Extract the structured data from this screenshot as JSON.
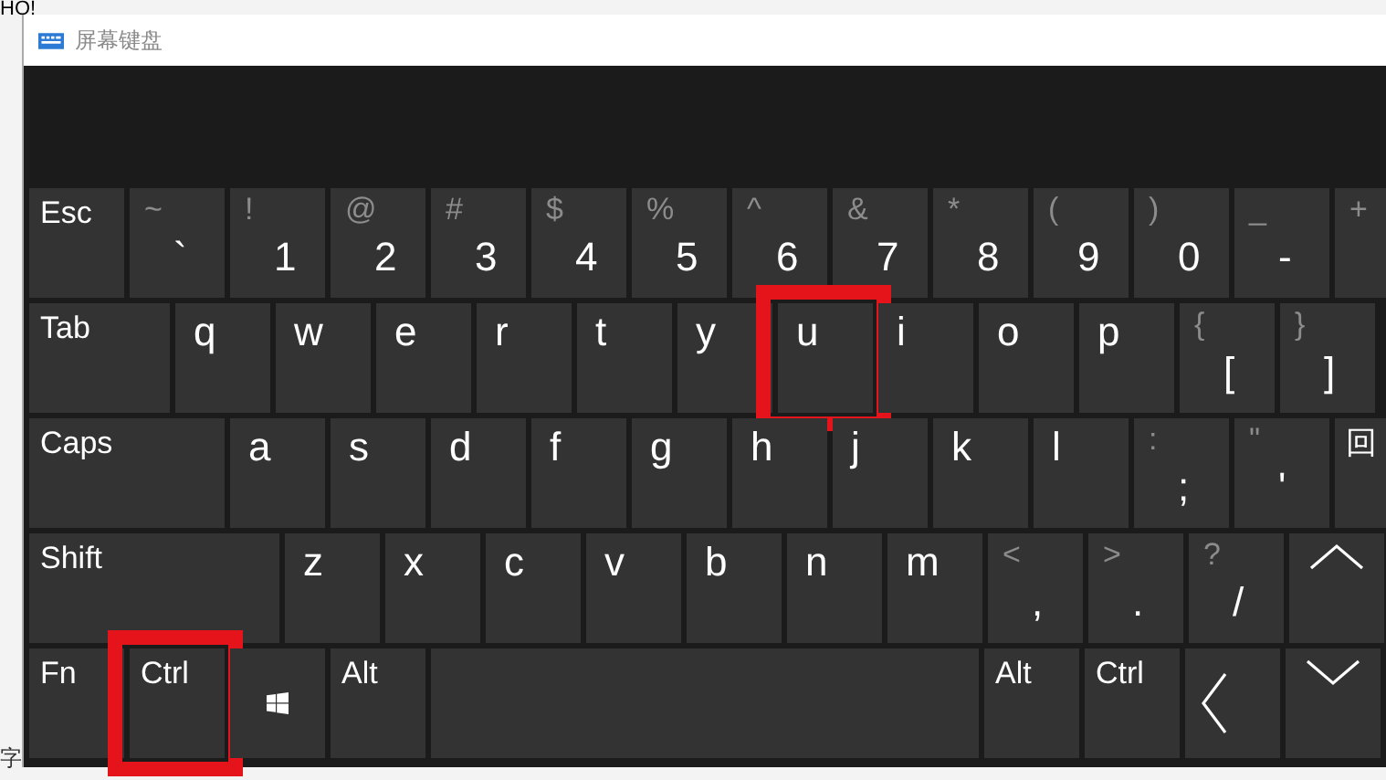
{
  "background_texts": [
    "HO!",
    "字"
  ],
  "window": {
    "title": "屏幕键盘"
  },
  "rows": [
    {
      "keys": [
        {
          "kind": "label",
          "label": "Esc"
        },
        {
          "kind": "symbol",
          "shift": "~",
          "main": "`"
        },
        {
          "kind": "symbol",
          "shift": "!",
          "main": "1"
        },
        {
          "kind": "symbol",
          "shift": "@",
          "main": "2"
        },
        {
          "kind": "symbol",
          "shift": "#",
          "main": "3"
        },
        {
          "kind": "symbol",
          "shift": "$",
          "main": "4"
        },
        {
          "kind": "symbol",
          "shift": "%",
          "main": "5"
        },
        {
          "kind": "symbol",
          "shift": "^",
          "main": "6"
        },
        {
          "kind": "symbol",
          "shift": "&",
          "main": "7"
        },
        {
          "kind": "symbol",
          "shift": "*",
          "main": "8"
        },
        {
          "kind": "symbol",
          "shift": "(",
          "main": "9"
        },
        {
          "kind": "symbol",
          "shift": ")",
          "main": "0"
        },
        {
          "kind": "symbol",
          "shift": "_",
          "main": "-"
        },
        {
          "kind": "symbol",
          "shift": "+"
        }
      ]
    },
    {
      "keys": [
        {
          "kind": "label",
          "label": "Tab"
        },
        {
          "kind": "letter",
          "label": "q"
        },
        {
          "kind": "letter",
          "label": "w"
        },
        {
          "kind": "letter",
          "label": "e"
        },
        {
          "kind": "letter",
          "label": "r"
        },
        {
          "kind": "letter",
          "label": "t"
        },
        {
          "kind": "letter",
          "label": "y"
        },
        {
          "kind": "letter",
          "label": "u",
          "highlighted": true
        },
        {
          "kind": "letter",
          "label": "i"
        },
        {
          "kind": "letter",
          "label": "o"
        },
        {
          "kind": "letter",
          "label": "p"
        },
        {
          "kind": "symbol",
          "shift": "{",
          "main": "["
        },
        {
          "kind": "symbol",
          "shift": "}",
          "main": "]"
        }
      ]
    },
    {
      "keys": [
        {
          "kind": "label",
          "label": "Caps"
        },
        {
          "kind": "letter",
          "label": "a"
        },
        {
          "kind": "letter",
          "label": "s"
        },
        {
          "kind": "letter",
          "label": "d"
        },
        {
          "kind": "letter",
          "label": "f"
        },
        {
          "kind": "letter",
          "label": "g"
        },
        {
          "kind": "letter",
          "label": "h"
        },
        {
          "kind": "letter",
          "label": "j"
        },
        {
          "kind": "letter",
          "label": "k"
        },
        {
          "kind": "letter",
          "label": "l"
        },
        {
          "kind": "symbol",
          "shift": ":",
          "main": ";"
        },
        {
          "kind": "symbol",
          "shift": "\"",
          "main": "'"
        },
        {
          "kind": "label",
          "label": "回"
        }
      ]
    },
    {
      "keys": [
        {
          "kind": "label",
          "label": "Shift"
        },
        {
          "kind": "letter",
          "label": "z"
        },
        {
          "kind": "letter",
          "label": "x"
        },
        {
          "kind": "letter",
          "label": "c"
        },
        {
          "kind": "letter",
          "label": "v"
        },
        {
          "kind": "letter",
          "label": "b"
        },
        {
          "kind": "letter",
          "label": "n"
        },
        {
          "kind": "letter",
          "label": "m"
        },
        {
          "kind": "symbol",
          "shift": "<",
          "main": ","
        },
        {
          "kind": "symbol",
          "shift": ">",
          "main": "."
        },
        {
          "kind": "symbol",
          "shift": "?",
          "main": "/"
        },
        {
          "kind": "up"
        }
      ]
    },
    {
      "keys": [
        {
          "kind": "label",
          "label": "Fn"
        },
        {
          "kind": "label",
          "label": "Ctrl",
          "highlighted": true
        },
        {
          "kind": "windows"
        },
        {
          "kind": "label",
          "label": "Alt"
        },
        {
          "kind": "space"
        },
        {
          "kind": "label",
          "label": "Alt"
        },
        {
          "kind": "label",
          "label": "Ctrl"
        },
        {
          "kind": "left"
        },
        {
          "kind": "down"
        }
      ]
    }
  ]
}
